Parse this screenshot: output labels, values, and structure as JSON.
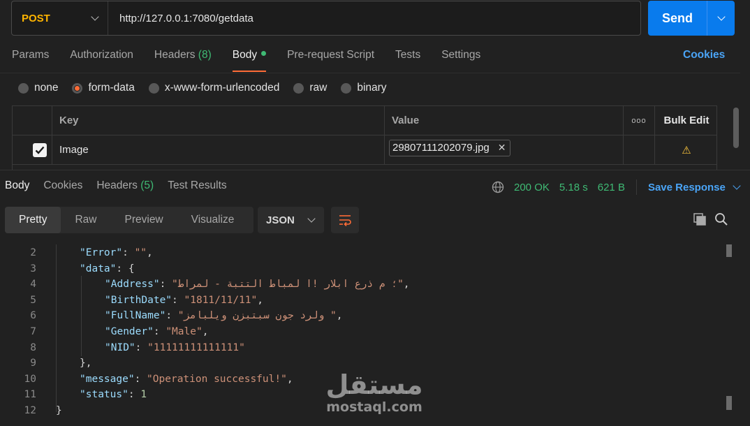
{
  "request": {
    "method": "POST",
    "url": "http://127.0.0.1:7080/getdata",
    "send_label": "Send"
  },
  "req_tabs": [
    {
      "label": "Params"
    },
    {
      "label": "Authorization"
    },
    {
      "label": "Headers",
      "count": "(8)"
    },
    {
      "label": "Body"
    },
    {
      "label": "Pre-request Script"
    },
    {
      "label": "Tests"
    },
    {
      "label": "Settings"
    }
  ],
  "cookies_label": "Cookies",
  "body_modes": [
    {
      "label": "none"
    },
    {
      "label": "form-data",
      "selected": true
    },
    {
      "label": "x-www-form-urlencoded"
    },
    {
      "label": "raw"
    },
    {
      "label": "binary"
    }
  ],
  "form_table": {
    "headers": {
      "key": "Key",
      "value": "Value",
      "bulk_edit": "Bulk Edit",
      "more": "ooo"
    },
    "rows": [
      {
        "checked": true,
        "key": "Image",
        "value_file": "29807111202079.jpg",
        "warning": "⚠"
      }
    ]
  },
  "response": {
    "tabs": [
      {
        "label": "Body"
      },
      {
        "label": "Cookies"
      },
      {
        "label": "Headers",
        "count": "(5)"
      },
      {
        "label": "Test Results"
      }
    ],
    "status": "200 OK",
    "time": "5.18 s",
    "size": "621 B",
    "save_label": "Save Response",
    "views": [
      "Pretty",
      "Raw",
      "Preview",
      "Visualize"
    ],
    "format": "JSON"
  },
  "code": {
    "lines": [
      {
        "n": "2",
        "k": "\"Error\"",
        "sep": ": ",
        "v": "\"\"",
        "t": "str",
        "end": ",",
        "indent": 1
      },
      {
        "n": "3",
        "k": "\"data\"",
        "sep": ": ",
        "v": "{",
        "t": "punc",
        "end": "",
        "indent": 1
      },
      {
        "n": "4",
        "k": "\"Address\"",
        "sep": ": ",
        "v": "\"؛ م ذرع ابلار !ا لمباط التتبة - لمراط\"",
        "t": "str",
        "end": ",",
        "indent": 2
      },
      {
        "n": "5",
        "k": "\"BirthDate\"",
        "sep": ": ",
        "v": "\"1811/11/11\"",
        "t": "str",
        "end": ",",
        "indent": 2
      },
      {
        "n": "6",
        "k": "\"FullName\"",
        "sep": ": ",
        "v": "\"ولرد جون سبتبزن ويلبامز \"",
        "t": "str",
        "end": ",",
        "indent": 2
      },
      {
        "n": "7",
        "k": "\"Gender\"",
        "sep": ": ",
        "v": "\"Male\"",
        "t": "str",
        "end": ",",
        "indent": 2
      },
      {
        "n": "8",
        "k": "\"NID\"",
        "sep": ": ",
        "v": "\"11111111111111\"",
        "t": "str",
        "end": "",
        "indent": 2
      },
      {
        "n": "9",
        "k": "",
        "sep": "",
        "v": "},",
        "t": "punc",
        "end": "",
        "indent": 1
      },
      {
        "n": "10",
        "k": "\"message\"",
        "sep": ": ",
        "v": "\"Operation successful!\"",
        "t": "str",
        "end": ",",
        "indent": 1
      },
      {
        "n": "11",
        "k": "\"status\"",
        "sep": ": ",
        "v": "1",
        "t": "num",
        "end": "",
        "indent": 1
      },
      {
        "n": "12",
        "k": "",
        "sep": "",
        "v": "}",
        "t": "punc",
        "end": "",
        "indent": 0
      }
    ]
  },
  "watermark": {
    "arabic": "مستقل",
    "latin": "mostaql.com"
  },
  "colors": {
    "accent_blue": "#097bed",
    "method_orange": "#ffb400",
    "active_orange": "#ff6c37",
    "status_green": "#3fba74",
    "link_blue": "#4aa4f6"
  }
}
